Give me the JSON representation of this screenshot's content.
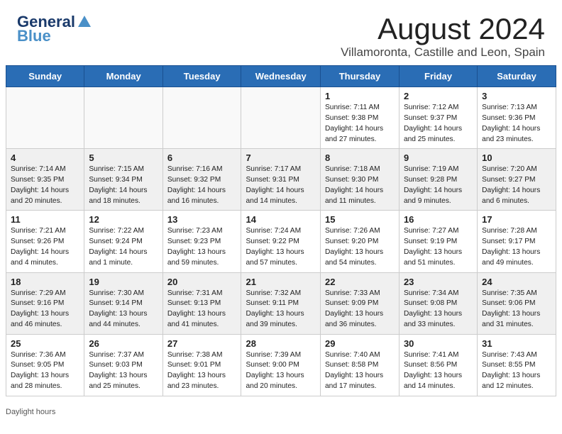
{
  "header": {
    "logo_line1": "General",
    "logo_line2": "Blue",
    "main_title": "August 2024",
    "subtitle": "Villamoronta, Castille and Leon, Spain"
  },
  "days_of_week": [
    "Sunday",
    "Monday",
    "Tuesday",
    "Wednesday",
    "Thursday",
    "Friday",
    "Saturday"
  ],
  "footer_text": "Daylight hours",
  "weeks": [
    [
      {
        "day": "",
        "empty": true
      },
      {
        "day": "",
        "empty": true
      },
      {
        "day": "",
        "empty": true
      },
      {
        "day": "",
        "empty": true
      },
      {
        "day": "1",
        "sunrise": "Sunrise: 7:11 AM",
        "sunset": "Sunset: 9:38 PM",
        "daylight": "Daylight: 14 hours and 27 minutes."
      },
      {
        "day": "2",
        "sunrise": "Sunrise: 7:12 AM",
        "sunset": "Sunset: 9:37 PM",
        "daylight": "Daylight: 14 hours and 25 minutes."
      },
      {
        "day": "3",
        "sunrise": "Sunrise: 7:13 AM",
        "sunset": "Sunset: 9:36 PM",
        "daylight": "Daylight: 14 hours and 23 minutes."
      }
    ],
    [
      {
        "day": "4",
        "sunrise": "Sunrise: 7:14 AM",
        "sunset": "Sunset: 9:35 PM",
        "daylight": "Daylight: 14 hours and 20 minutes."
      },
      {
        "day": "5",
        "sunrise": "Sunrise: 7:15 AM",
        "sunset": "Sunset: 9:34 PM",
        "daylight": "Daylight: 14 hours and 18 minutes."
      },
      {
        "day": "6",
        "sunrise": "Sunrise: 7:16 AM",
        "sunset": "Sunset: 9:32 PM",
        "daylight": "Daylight: 14 hours and 16 minutes."
      },
      {
        "day": "7",
        "sunrise": "Sunrise: 7:17 AM",
        "sunset": "Sunset: 9:31 PM",
        "daylight": "Daylight: 14 hours and 14 minutes."
      },
      {
        "day": "8",
        "sunrise": "Sunrise: 7:18 AM",
        "sunset": "Sunset: 9:30 PM",
        "daylight": "Daylight: 14 hours and 11 minutes."
      },
      {
        "day": "9",
        "sunrise": "Sunrise: 7:19 AM",
        "sunset": "Sunset: 9:28 PM",
        "daylight": "Daylight: 14 hours and 9 minutes."
      },
      {
        "day": "10",
        "sunrise": "Sunrise: 7:20 AM",
        "sunset": "Sunset: 9:27 PM",
        "daylight": "Daylight: 14 hours and 6 minutes."
      }
    ],
    [
      {
        "day": "11",
        "sunrise": "Sunrise: 7:21 AM",
        "sunset": "Sunset: 9:26 PM",
        "daylight": "Daylight: 14 hours and 4 minutes."
      },
      {
        "day": "12",
        "sunrise": "Sunrise: 7:22 AM",
        "sunset": "Sunset: 9:24 PM",
        "daylight": "Daylight: 14 hours and 1 minute."
      },
      {
        "day": "13",
        "sunrise": "Sunrise: 7:23 AM",
        "sunset": "Sunset: 9:23 PM",
        "daylight": "Daylight: 13 hours and 59 minutes."
      },
      {
        "day": "14",
        "sunrise": "Sunrise: 7:24 AM",
        "sunset": "Sunset: 9:22 PM",
        "daylight": "Daylight: 13 hours and 57 minutes."
      },
      {
        "day": "15",
        "sunrise": "Sunrise: 7:26 AM",
        "sunset": "Sunset: 9:20 PM",
        "daylight": "Daylight: 13 hours and 54 minutes."
      },
      {
        "day": "16",
        "sunrise": "Sunrise: 7:27 AM",
        "sunset": "Sunset: 9:19 PM",
        "daylight": "Daylight: 13 hours and 51 minutes."
      },
      {
        "day": "17",
        "sunrise": "Sunrise: 7:28 AM",
        "sunset": "Sunset: 9:17 PM",
        "daylight": "Daylight: 13 hours and 49 minutes."
      }
    ],
    [
      {
        "day": "18",
        "sunrise": "Sunrise: 7:29 AM",
        "sunset": "Sunset: 9:16 PM",
        "daylight": "Daylight: 13 hours and 46 minutes."
      },
      {
        "day": "19",
        "sunrise": "Sunrise: 7:30 AM",
        "sunset": "Sunset: 9:14 PM",
        "daylight": "Daylight: 13 hours and 44 minutes."
      },
      {
        "day": "20",
        "sunrise": "Sunrise: 7:31 AM",
        "sunset": "Sunset: 9:13 PM",
        "daylight": "Daylight: 13 hours and 41 minutes."
      },
      {
        "day": "21",
        "sunrise": "Sunrise: 7:32 AM",
        "sunset": "Sunset: 9:11 PM",
        "daylight": "Daylight: 13 hours and 39 minutes."
      },
      {
        "day": "22",
        "sunrise": "Sunrise: 7:33 AM",
        "sunset": "Sunset: 9:09 PM",
        "daylight": "Daylight: 13 hours and 36 minutes."
      },
      {
        "day": "23",
        "sunrise": "Sunrise: 7:34 AM",
        "sunset": "Sunset: 9:08 PM",
        "daylight": "Daylight: 13 hours and 33 minutes."
      },
      {
        "day": "24",
        "sunrise": "Sunrise: 7:35 AM",
        "sunset": "Sunset: 9:06 PM",
        "daylight": "Daylight: 13 hours and 31 minutes."
      }
    ],
    [
      {
        "day": "25",
        "sunrise": "Sunrise: 7:36 AM",
        "sunset": "Sunset: 9:05 PM",
        "daylight": "Daylight: 13 hours and 28 minutes."
      },
      {
        "day": "26",
        "sunrise": "Sunrise: 7:37 AM",
        "sunset": "Sunset: 9:03 PM",
        "daylight": "Daylight: 13 hours and 25 minutes."
      },
      {
        "day": "27",
        "sunrise": "Sunrise: 7:38 AM",
        "sunset": "Sunset: 9:01 PM",
        "daylight": "Daylight: 13 hours and 23 minutes."
      },
      {
        "day": "28",
        "sunrise": "Sunrise: 7:39 AM",
        "sunset": "Sunset: 9:00 PM",
        "daylight": "Daylight: 13 hours and 20 minutes."
      },
      {
        "day": "29",
        "sunrise": "Sunrise: 7:40 AM",
        "sunset": "Sunset: 8:58 PM",
        "daylight": "Daylight: 13 hours and 17 minutes."
      },
      {
        "day": "30",
        "sunrise": "Sunrise: 7:41 AM",
        "sunset": "Sunset: 8:56 PM",
        "daylight": "Daylight: 13 hours and 14 minutes."
      },
      {
        "day": "31",
        "sunrise": "Sunrise: 7:43 AM",
        "sunset": "Sunset: 8:55 PM",
        "daylight": "Daylight: 13 hours and 12 minutes."
      }
    ]
  ]
}
